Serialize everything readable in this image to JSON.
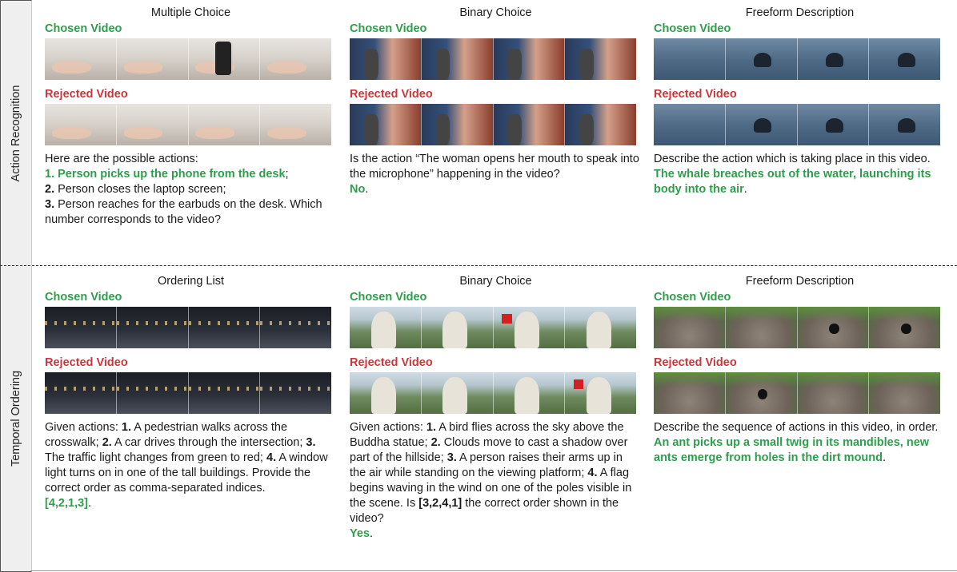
{
  "rows": [
    {
      "label": "Action Recognition",
      "columns": [
        {
          "title": "Multiple Choice",
          "chosen_label": "Chosen Video",
          "rejected_label": "Rejected Video",
          "chosen_frames": [
            "office",
            "office",
            "office phone",
            "office"
          ],
          "rejected_frames": [
            "office",
            "office",
            "office",
            "office"
          ],
          "text_segments": [
            {
              "t": "Here are the possible actions:",
              "s": "n",
              "br": true
            },
            {
              "t": "1. Person picks up the phone from the desk",
              "s": "g"
            },
            {
              "t": ";",
              "s": "n",
              "br": true
            },
            {
              "t": "2.",
              "s": "b"
            },
            {
              "t": " Person closes the laptop screen;",
              "s": "n",
              "br": true
            },
            {
              "t": "3.",
              "s": "b"
            },
            {
              "t": " Person reaches for the earbuds on the desk. Which number corresponds to the video?",
              "s": "n"
            }
          ]
        },
        {
          "title": "Binary Choice",
          "chosen_label": "Chosen Video",
          "rejected_label": "Rejected Video",
          "chosen_frames": [
            "singer",
            "singer",
            "singer",
            "singer"
          ],
          "rejected_frames": [
            "singer",
            "singer",
            "singer",
            "singer"
          ],
          "text_segments": [
            {
              "t": "Is the action “The woman opens her mouth to speak into the microphone” happening in the video?",
              "s": "n",
              "br": true
            },
            {
              "t": "No",
              "s": "g"
            },
            {
              "t": ".",
              "s": "n"
            }
          ]
        },
        {
          "title": "Freeform Description",
          "chosen_label": "Chosen Video",
          "rejected_label": "Rejected Video",
          "chosen_frames": [
            "sea",
            "sea whale",
            "sea whale",
            "sea whale"
          ],
          "rejected_frames": [
            "sea",
            "sea whale",
            "sea whale",
            "sea whale"
          ],
          "text_segments": [
            {
              "t": "Describe the action which is taking place in this video.",
              "s": "n",
              "br": true
            },
            {
              "t": "The whale breaches out of the water, launching its body into the air",
              "s": "g"
            },
            {
              "t": ".",
              "s": "n"
            }
          ]
        }
      ]
    },
    {
      "label": "Temporal Ordering",
      "columns": [
        {
          "title": "Ordering List",
          "chosen_label": "Chosen Video",
          "rejected_label": "Rejected Video",
          "chosen_frames": [
            "city",
            "city",
            "city",
            "city"
          ],
          "rejected_frames": [
            "city",
            "city",
            "city",
            "city"
          ],
          "text_segments": [
            {
              "t": "Given actions: ",
              "s": "n"
            },
            {
              "t": "1.",
              "s": "b"
            },
            {
              "t": " A pedestrian walks across the crosswalk; ",
              "s": "n"
            },
            {
              "t": "2.",
              "s": "b"
            },
            {
              "t": " A car drives through the intersection; ",
              "s": "n"
            },
            {
              "t": "3.",
              "s": "b"
            },
            {
              "t": " The traffic light changes from green to red; ",
              "s": "n"
            },
            {
              "t": "4.",
              "s": "b"
            },
            {
              "t": " A window light turns on in one of the tall buildings. Provide the correct order as comma-separated indices.",
              "s": "n",
              "br": true
            },
            {
              "t": "[4,2,1,3]",
              "s": "g"
            },
            {
              "t": ".",
              "s": "n"
            }
          ]
        },
        {
          "title": "Binary Choice",
          "chosen_label": "Chosen Video",
          "rejected_label": "Rejected Video",
          "chosen_frames": [
            "buddha",
            "buddha",
            "buddha flag",
            "buddha"
          ],
          "rejected_frames": [
            "buddha",
            "buddha",
            "buddha",
            "buddha flag"
          ],
          "text_segments": [
            {
              "t": "Given actions: ",
              "s": "n"
            },
            {
              "t": "1.",
              "s": "b"
            },
            {
              "t": " A bird flies across the sky above the Buddha statue; ",
              "s": "n"
            },
            {
              "t": "2.",
              "s": "b"
            },
            {
              "t": " Clouds move to cast a shadow over part of the hillside; ",
              "s": "n"
            },
            {
              "t": "3.",
              "s": "b"
            },
            {
              "t": " A person raises their arms up in the air while standing on the viewing platform; ",
              "s": "n"
            },
            {
              "t": "4.",
              "s": "b"
            },
            {
              "t": " A flag begins waving in the wind on one of the poles visible in the scene. Is ",
              "s": "n"
            },
            {
              "t": "[3,2,4,1]",
              "s": "b"
            },
            {
              "t": " the correct order shown in the video?",
              "s": "n",
              "br": true
            },
            {
              "t": "Yes",
              "s": "g"
            },
            {
              "t": ".",
              "s": "n"
            }
          ]
        },
        {
          "title": "Freeform Description",
          "chosen_label": "Chosen Video",
          "rejected_label": "Rejected Video",
          "chosen_frames": [
            "ant",
            "ant",
            "ant hole",
            "ant hole"
          ],
          "rejected_frames": [
            "ant",
            "ant hole",
            "ant",
            "ant"
          ],
          "text_segments": [
            {
              "t": "Describe the sequence of actions in this video, in order.",
              "s": "n",
              "br": true
            },
            {
              "t": "An ant picks up a small twig in its mandibles, new ants emerge from holes in the dirt mound",
              "s": "g"
            },
            {
              "t": ".",
              "s": "n"
            }
          ]
        }
      ]
    }
  ]
}
